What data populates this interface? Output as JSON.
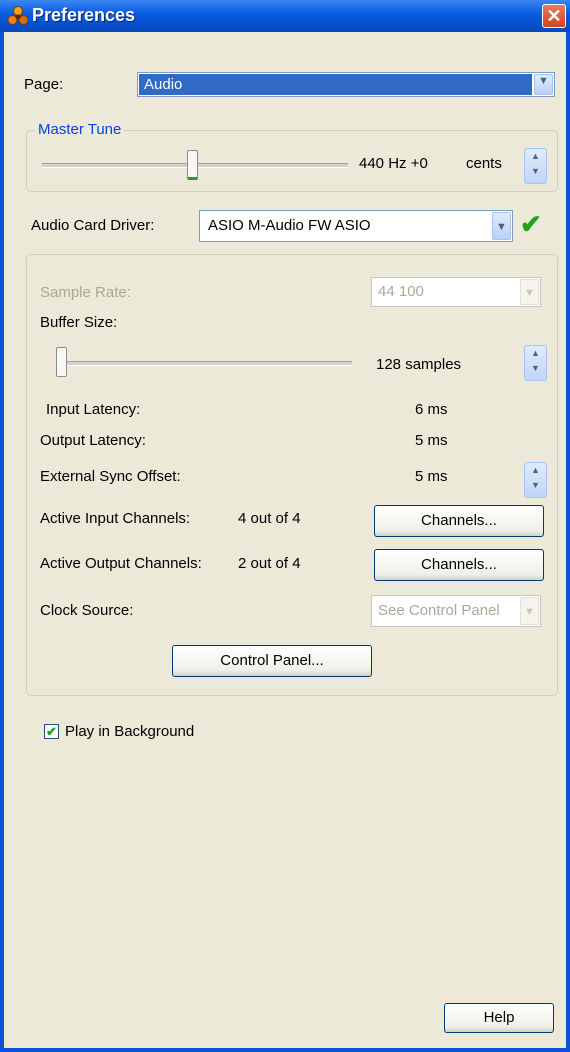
{
  "window": {
    "title": "Preferences",
    "close_glyph": "✕"
  },
  "page": {
    "label": "Page:",
    "value": "Audio"
  },
  "master_tune": {
    "legend": "Master Tune",
    "value": "440 Hz +0",
    "unit": "cents",
    "slider_level": 0.5
  },
  "driver": {
    "label": "Audio Card Driver:",
    "value": "ASIO M-Audio FW ASIO",
    "status_glyph": "✔"
  },
  "audio": {
    "sample_rate": {
      "label": "Sample Rate:",
      "value": "44 100"
    },
    "buffer_size": {
      "label": "Buffer Size:",
      "value": "128 samples",
      "slider_level": 0.0
    },
    "input_latency": {
      "label": "Input Latency:",
      "value": "6 ms"
    },
    "output_latency": {
      "label": "Output Latency:",
      "value": "5 ms"
    },
    "external_sync": {
      "label": "External Sync Offset:",
      "value": "5 ms"
    },
    "input_channels": {
      "label": "Active Input Channels:",
      "value": "4 out of 4",
      "button": "Channels..."
    },
    "output_channels": {
      "label": "Active Output Channels:",
      "value": "2 out of 4",
      "button": "Channels..."
    },
    "clock_source": {
      "label": "Clock Source:",
      "value": "See Control Panel"
    },
    "control_panel_button": "Control Panel..."
  },
  "play_in_background": {
    "label": "Play in Background",
    "checked": true,
    "check_glyph": "✔"
  },
  "help_button": "Help",
  "icons": {
    "arrow_down": "▼",
    "spin_up": "▲",
    "spin_down": "▼"
  },
  "colors": {
    "titlebar": "#0a5fe0",
    "selection": "#316ac5",
    "check": "#21a121",
    "legend": "#0046d5"
  }
}
